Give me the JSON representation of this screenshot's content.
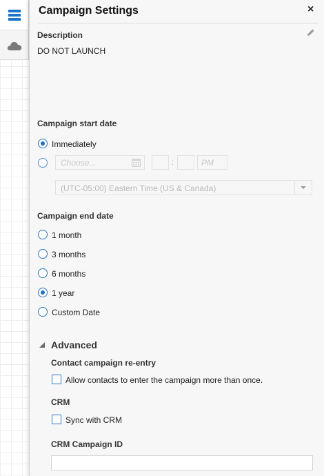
{
  "toolbar": {
    "items": [
      {
        "icon": "list-icon",
        "color": "#1a73c7"
      },
      {
        "icon": "cloud-icon",
        "color": "#7a7a7a"
      }
    ]
  },
  "panel": {
    "title": "Campaign Settings",
    "close_glyph": "×",
    "description": {
      "label": "Description",
      "value": "DO NOT LAUNCH"
    },
    "start_date": {
      "label": "Campaign start date",
      "option_immediately": "Immediately",
      "date_placeholder": "Choose...",
      "time_separator": ":",
      "ampm_placeholder": "PM",
      "timezone": "(UTC-05:00) Eastern Time (US & Canada)"
    },
    "end_date": {
      "label": "Campaign end date",
      "options": [
        "1 month",
        "3 months",
        "6 months",
        "1 year",
        "Custom Date"
      ],
      "selected": "1 year"
    },
    "advanced": {
      "label": "Advanced",
      "reentry_label": "Contact campaign re-entry",
      "reentry_checkbox": "Allow contacts to enter the campaign more than once.",
      "crm_label": "CRM",
      "crm_checkbox": "Sync with CRM",
      "crm_id_label": "CRM Campaign ID",
      "crm_id_value": ""
    }
  },
  "colors": {
    "accent": "#1a73c7",
    "panel_bg": "#f7f7f7"
  }
}
